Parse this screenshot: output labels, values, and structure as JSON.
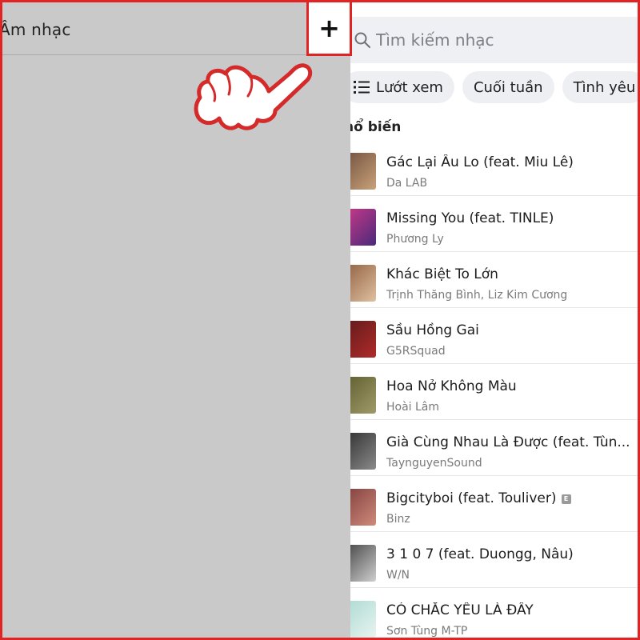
{
  "left": {
    "title": "Âm nhạc",
    "add_label": "+"
  },
  "search": {
    "placeholder": "Tìm kiếm nhạc"
  },
  "chips": [
    {
      "label": "Lướt xem",
      "icon": "list-icon"
    },
    {
      "label": "Cuối tuần"
    },
    {
      "label": "Tình yêu"
    }
  ],
  "section": {
    "title": "hổ biến"
  },
  "songs": [
    {
      "title": "Gác Lại Âu Lo (feat. Miu Lê)",
      "artist": "Da LAB",
      "explicit": false,
      "thumb_colors": [
        "#6b4a3a",
        "#c9a27a"
      ]
    },
    {
      "title": "Missing You (feat. TINLE)",
      "artist": "Phương Ly",
      "explicit": false,
      "thumb_colors": [
        "#d43a8a",
        "#4a2a7a"
      ]
    },
    {
      "title": "Khác Biệt To Lớn",
      "artist": "Trịnh Thăng Bình, Liz Kim Cương",
      "explicit": false,
      "thumb_colors": [
        "#8a5a3a",
        "#e0c0a0"
      ]
    },
    {
      "title": "Sầu Hồng Gai",
      "artist": "G5RSquad",
      "explicit": false,
      "thumb_colors": [
        "#5a1a1a",
        "#b02a2a"
      ]
    },
    {
      "title": "Hoa Nở Không Màu",
      "artist": "Hoài Lâm",
      "explicit": false,
      "thumb_colors": [
        "#5a5a2a",
        "#a09a6a"
      ]
    },
    {
      "title": "Già Cùng Nhau Là Được (feat. Tùn...",
      "artist": "TaynguyenSound",
      "explicit": false,
      "thumb_colors": [
        "#2a2a2a",
        "#8a8a8a"
      ]
    },
    {
      "title": "Bigcityboi (feat. Touliver)",
      "artist": "Binz",
      "explicit": true,
      "explicit_label": "E",
      "thumb_colors": [
        "#7a3a3a",
        "#d08a7a"
      ]
    },
    {
      "title": "3 1 0 7 (feat. Duongg, Nâu)",
      "artist": "W/N",
      "explicit": false,
      "thumb_colors": [
        "#3a3a3a",
        "#cfcfcf"
      ]
    },
    {
      "title": "CÓ CHẮC YÊU LÀ ĐÂY",
      "artist": "Sơn Tùng M-TP",
      "explicit": false,
      "thumb_colors": [
        "#a8d8d0",
        "#e8f4f0"
      ]
    }
  ],
  "colors": {
    "accent_red": "#e02424",
    "left_bg": "#c9c9c9",
    "search_bg": "#eef0f3"
  }
}
